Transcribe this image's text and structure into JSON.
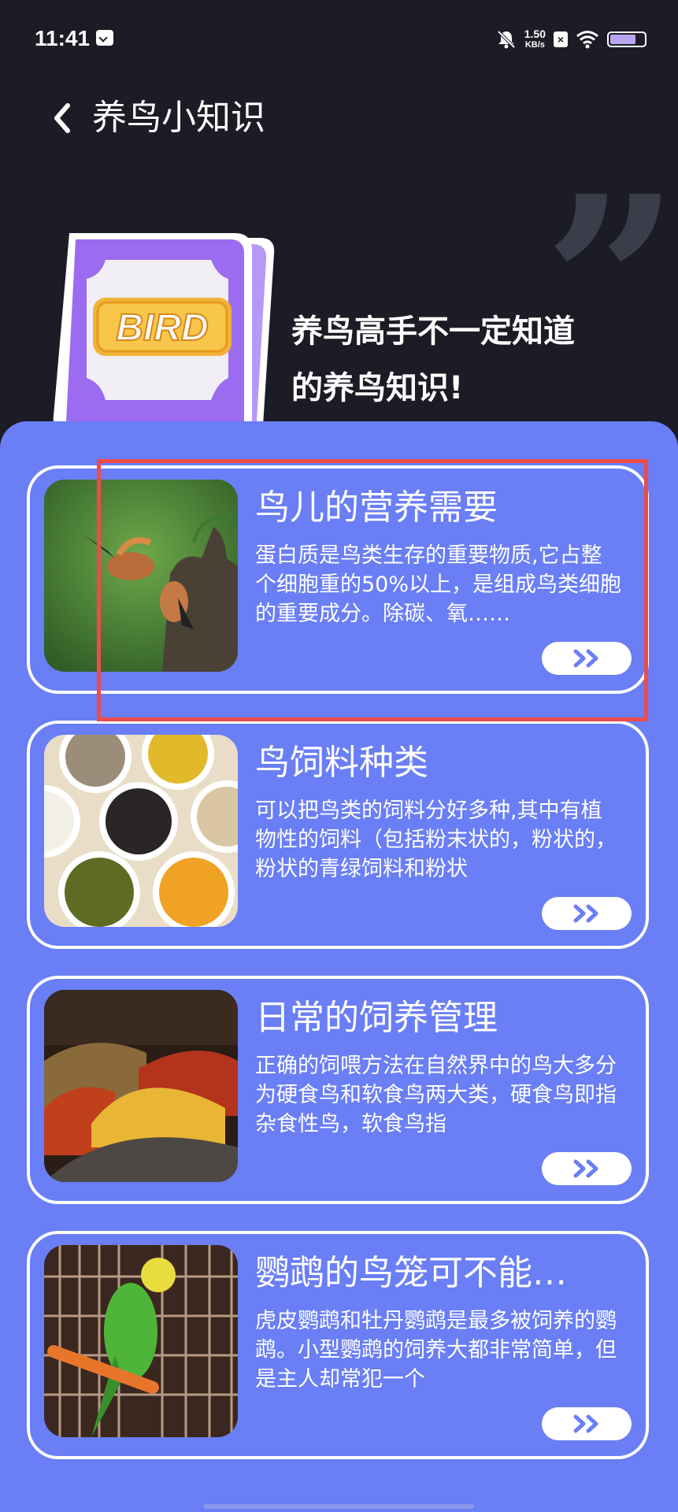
{
  "status_bar": {
    "time": "11:41",
    "net_speed_value": "1.50",
    "net_speed_unit": "KB/s"
  },
  "header": {
    "title": "养鸟小知识"
  },
  "banner": {
    "book_label": "BIRD",
    "headline_line1": "养鸟高手不一定知道",
    "headline_line2": "的养鸟知识!"
  },
  "cards": [
    {
      "title": "鸟儿的营养需要",
      "description": "蛋白质是鸟类生存的重要物质,它占整个细胞重的50%以上，是组成鸟类细胞的重要成分。除碳、氧……",
      "image": "hoopoe-birds-photo"
    },
    {
      "title": "鸟饲料种类",
      "description": "可以把鸟类的饲料分好多种,其中有植物性的饲料（包括粉末状的，粉状的，粉状的青绿饲料和粉状",
      "image": "grain-bowls-photo"
    },
    {
      "title": "日常的饲养管理",
      "description": "正确的饲喂方法在自然界中的鸟大多分为硬食鸟和软食鸟两大类，硬食鸟即指杂食性鸟，软食鸟指",
      "image": "spice-piles-photo"
    },
    {
      "title": "鹦鹉的鸟笼可不能…",
      "description": "虎皮鹦鹉和牡丹鹦鹉是最多被饲养的鹦鹉。小型鹦鹉的饲养大都非常简单，但是主人却常犯一个",
      "image": "budgie-cage-photo"
    }
  ],
  "colors": {
    "background": "#1b1c26",
    "panel": "#6a7ef5",
    "card_border": "#ffffff",
    "highlight": "#ee4b4b",
    "book": "#9b6bf0"
  }
}
